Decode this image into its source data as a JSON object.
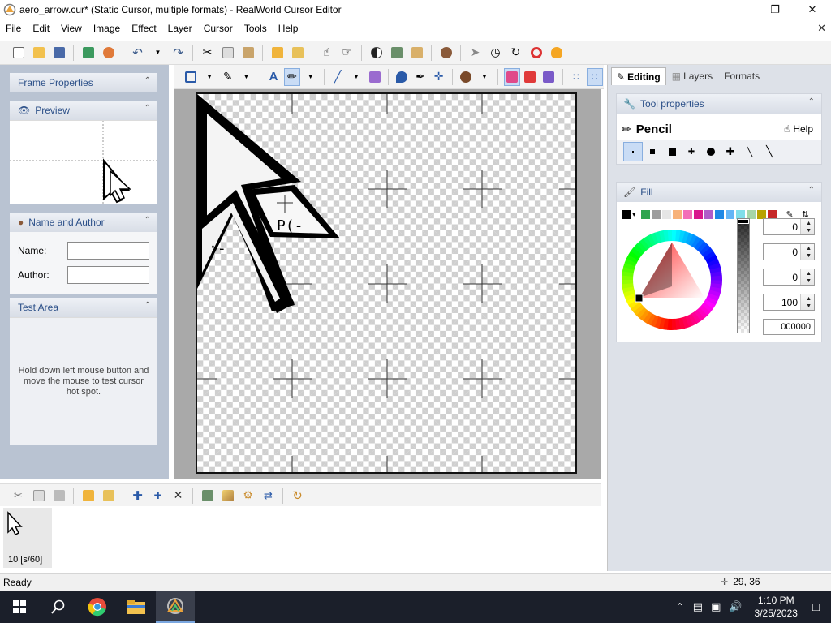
{
  "window": {
    "title": "aero_arrow.cur* (Static Cursor, multiple formats) - RealWorld Cursor Editor"
  },
  "menu": {
    "items": [
      "File",
      "Edit",
      "View",
      "Image",
      "Effect",
      "Layer",
      "Cursor",
      "Tools",
      "Help"
    ]
  },
  "left_panels": {
    "frame_properties": "Frame Properties",
    "preview": "Preview",
    "name_author": "Name and Author",
    "name_label": "Name:",
    "author_label": "Author:",
    "name_value": "",
    "author_value": "",
    "test_area": "Test Area",
    "test_hint": "Hold down left mouse button and move the mouse to test cursor hot spot."
  },
  "right_tabs": [
    "Editing",
    "Layers",
    "Formats"
  ],
  "tool_properties": {
    "header": "Tool properties",
    "tool_name": "Pencil",
    "help": "Help"
  },
  "fill": {
    "header": "Fill",
    "swatch_colors": [
      "#000000",
      "#2ea44f",
      "#9e9e9e",
      "#e6e6e6",
      "#f7b27a",
      "#f36fb8",
      "#d9168c",
      "#b05cc8",
      "#1e88e5",
      "#64b5f6",
      "#80deea",
      "#a5d6a7",
      "#b8a200",
      "#c62828"
    ],
    "values": [
      "0",
      "0",
      "0",
      "100"
    ],
    "hex": "000000"
  },
  "frames": {
    "label": "10 [s/60]"
  },
  "status": {
    "text": "Ready",
    "coords": "29, 36"
  },
  "taskbar": {
    "time": "1:10 PM",
    "date": "3/25/2023"
  }
}
